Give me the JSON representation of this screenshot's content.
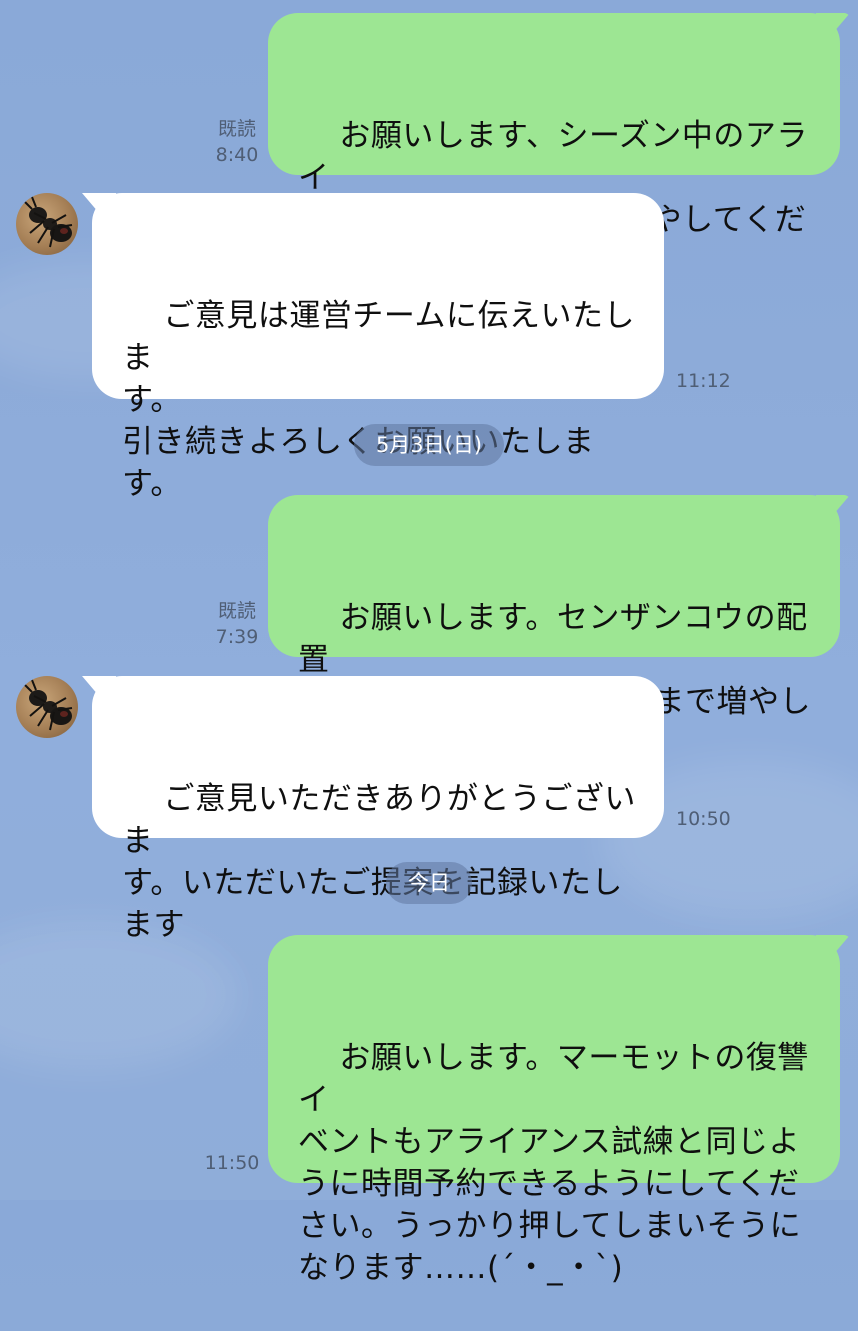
{
  "colors": {
    "background": "#8dabd9",
    "outgoing_bubble": "#9de693",
    "incoming_bubble": "#ffffff",
    "meta_text": "#4f5e75",
    "date_pill": "#6078a0"
  },
  "messages": [
    {
      "direction": "out",
      "text": "お願いします、シーズン中のアライ\nアンスマークを30まで増やしてくだ\nさい",
      "read_label": "既読",
      "time": "8:40"
    },
    {
      "direction": "in",
      "avatar_icon": "ant-avatar-icon",
      "text": "ご意見は運営チームに伝えいたしま\nす。\n引き続きよろしくお願いいたしま\nす。",
      "time": "11:12"
    },
    {
      "direction": "out",
      "text": "お願いします。センザンコウの配置\nを変えられるのを1日5回まで増やし\nてください",
      "read_label": "既読",
      "time": "7:39"
    },
    {
      "direction": "in",
      "avatar_icon": "ant-avatar-icon",
      "text": "ご意見いただきありがとうございま\nす。いただいたご提案を記録いたし\nます",
      "time": "10:50"
    },
    {
      "direction": "out",
      "text": "お願いします。マーモットの復讐イ\nベントもアライアンス試練と同じよ\nうに時間予約できるようにしてくだ\nさい。うっかり押してしまいそうに\nなります……(´・_・`)",
      "time": "11:50"
    }
  ],
  "date_separators": [
    "5月3日(日)",
    "今日"
  ]
}
